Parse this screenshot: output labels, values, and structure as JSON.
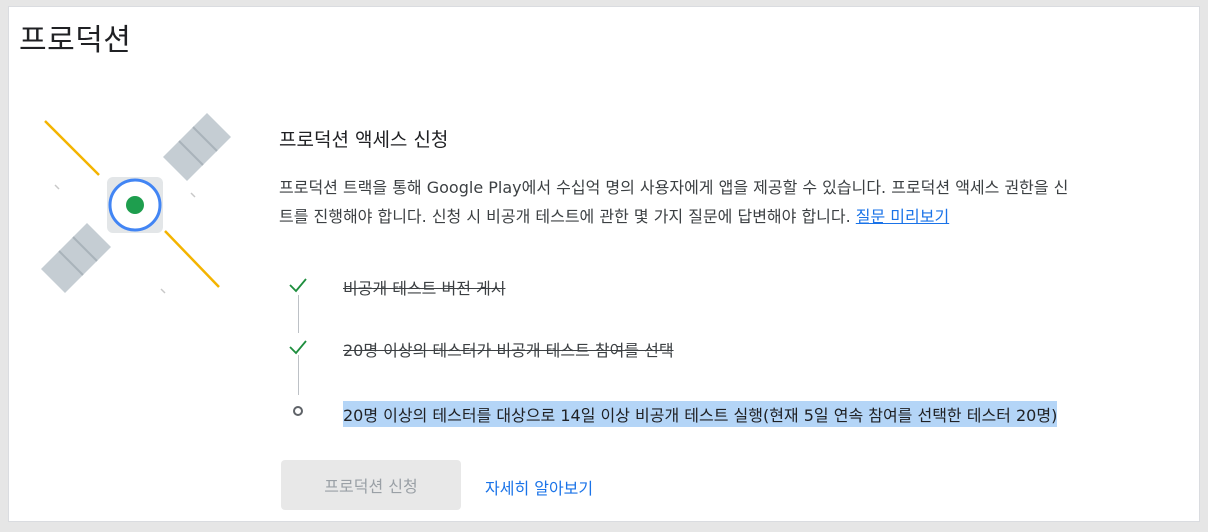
{
  "page": {
    "title": "프로덕션"
  },
  "section": {
    "title": "프로덕션 액세스 신청",
    "description_line1": "프로덕션 트랙을 통해 Google Play에서 수십억 명의 사용자에게 앱을 제공할 수 있습니다. 프로덕션 액세스 권한을 신",
    "description_line2": "트를 진행해야 합니다. 신청 시 비공개 테스트에 관한 몇 가지 질문에 답변해야 합니다.",
    "preview_link": "질문 미리보기"
  },
  "checklist": {
    "items": [
      {
        "label": "비공개 테스트 버전 게시",
        "status": "done",
        "icon": "check-icon"
      },
      {
        "label": "20명 이상의 테스터가 비공개 테스트 참여를 선택",
        "status": "done",
        "icon": "check-icon"
      },
      {
        "label": "20명 이상의 테스터를 대상으로 14일 이상 비공개 테스트 실행(현재 5일 연속 참여를 선택한 테스터 20명)",
        "status": "pending",
        "icon": "circle-outline-icon"
      }
    ]
  },
  "actions": {
    "apply_label": "프로덕션 신청",
    "learn_more_label": "자세히 알아보기"
  },
  "colors": {
    "accent": "#1a73e8",
    "check": "#1e8e3e",
    "disabled_button_bg": "#e8e8e8",
    "highlight": "#b4d5f7",
    "satellite_core": "#1e9e4e",
    "satellite_ring": "#4285f4",
    "satellite_panel": "#c5cdd3",
    "beam": "#f4b400"
  }
}
